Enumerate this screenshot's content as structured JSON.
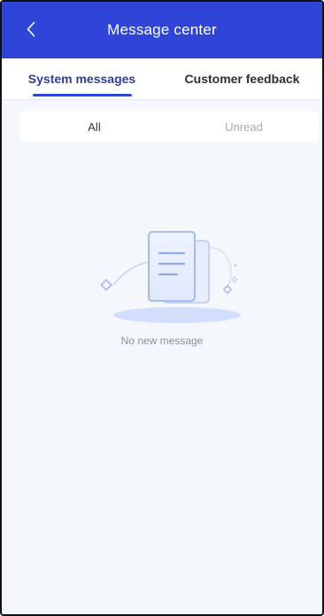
{
  "header": {
    "title": "Message center",
    "back_icon": "chevron-left-icon"
  },
  "tabs": [
    {
      "label": "System messages",
      "active": true
    },
    {
      "label": "Customer feedback",
      "active": false
    }
  ],
  "filters": [
    {
      "label": "All",
      "active": true
    },
    {
      "label": "Unread",
      "active": false
    }
  ],
  "empty_state": {
    "text": "No new message",
    "icon": "empty-document-icon"
  },
  "colors": {
    "header_bg": "#2f45d8",
    "active_tab": "#2f3d9a",
    "page_bg": "#f4f7fc"
  }
}
